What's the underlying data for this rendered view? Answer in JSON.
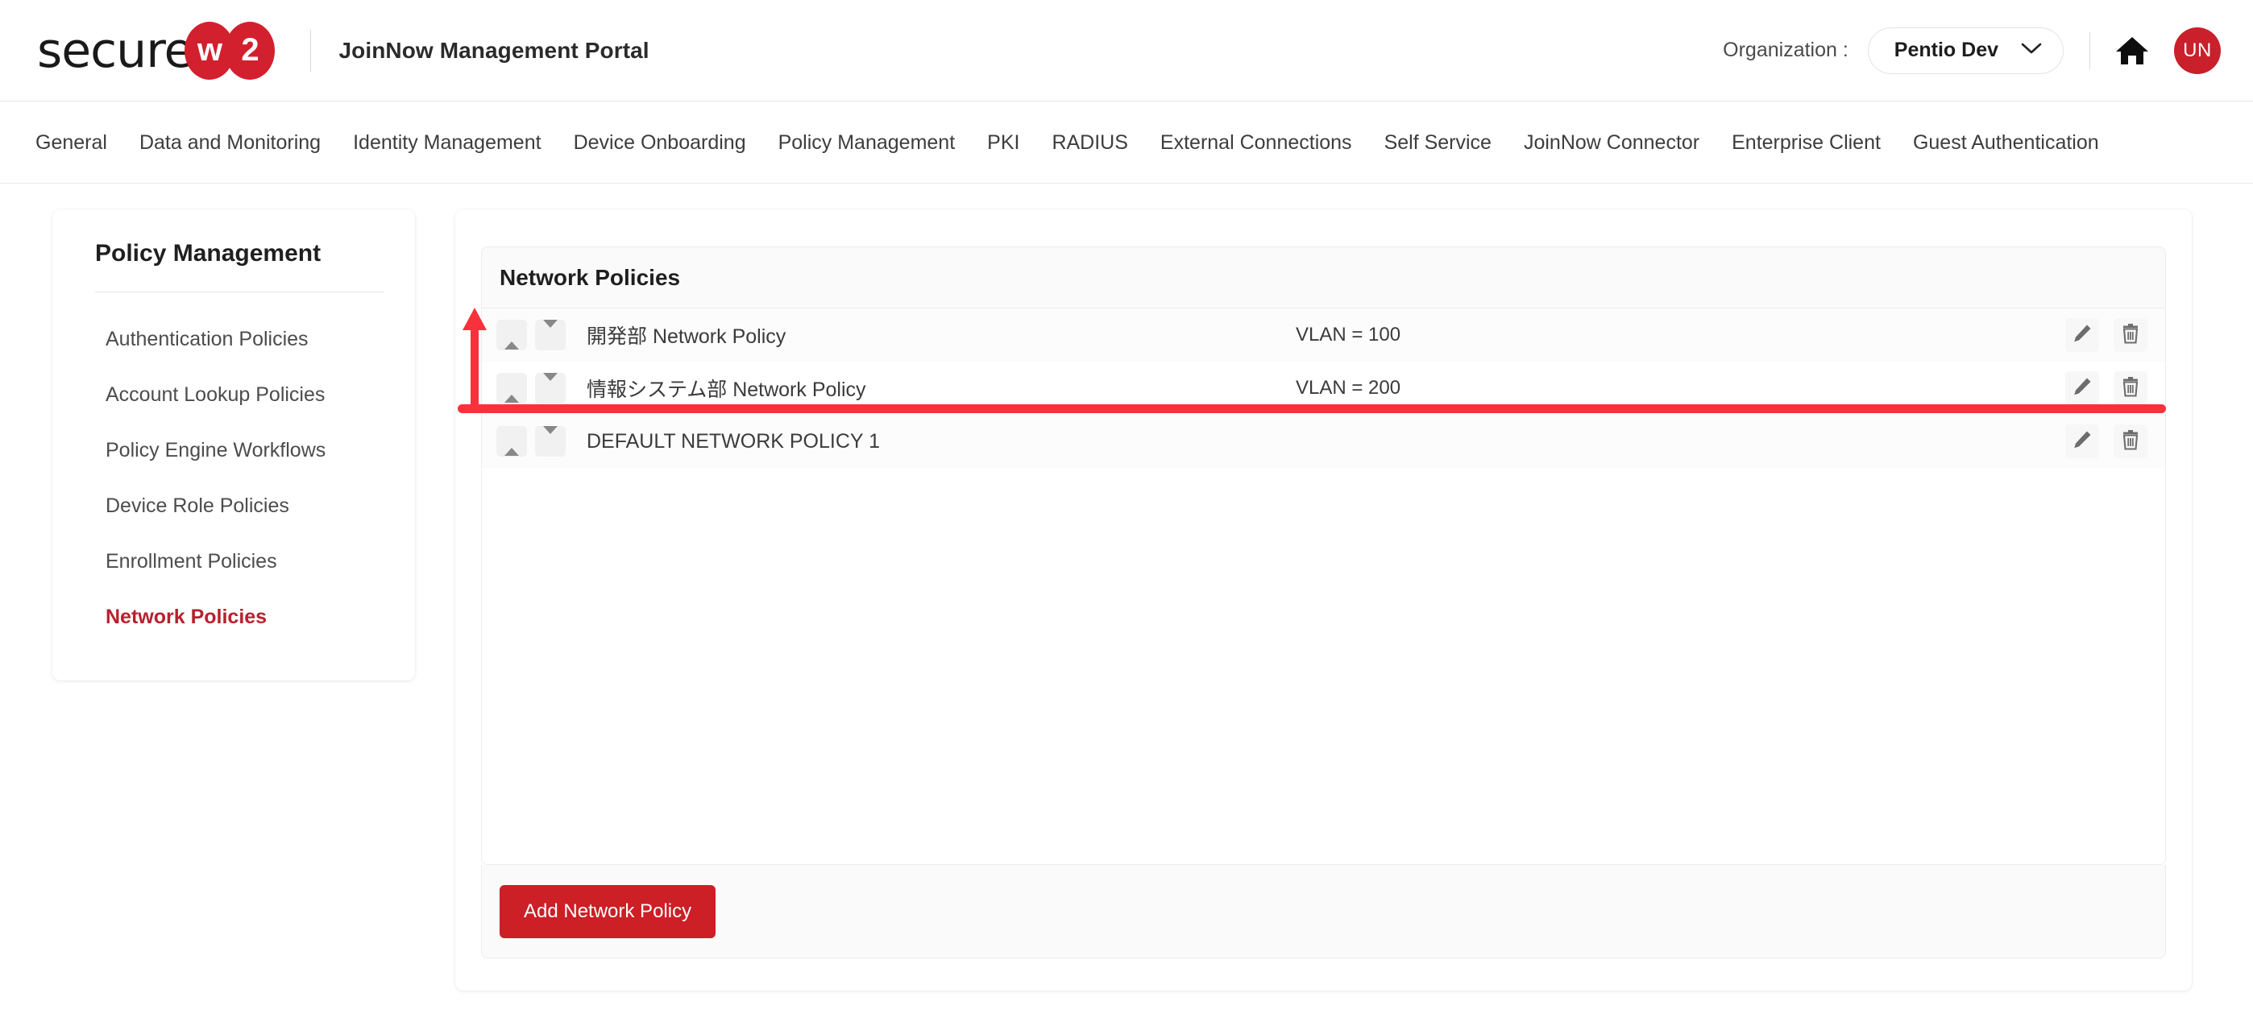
{
  "header": {
    "logo_text": "secure",
    "logo_w": "w",
    "logo_2": "2",
    "portal_title": "JoinNow Management Portal",
    "org_label": "Organization :",
    "org_value": "Pentio Dev",
    "chevron_icon": "chevron-down-icon",
    "home_icon": "home-icon",
    "avatar_initials": "UN"
  },
  "nav": {
    "items": [
      "General",
      "Data and Monitoring",
      "Identity Management",
      "Device Onboarding",
      "Policy Management",
      "PKI",
      "RADIUS",
      "External Connections",
      "Self Service",
      "JoinNow Connector",
      "Enterprise Client",
      "Guest Authentication"
    ]
  },
  "sidebar": {
    "title": "Policy Management",
    "items": [
      {
        "label": "Authentication Policies",
        "active": false
      },
      {
        "label": "Account Lookup Policies",
        "active": false
      },
      {
        "label": "Policy Engine Workflows",
        "active": false
      },
      {
        "label": "Device Role Policies",
        "active": false
      },
      {
        "label": "Enrollment Policies",
        "active": false
      },
      {
        "label": "Network Policies",
        "active": true
      }
    ]
  },
  "main": {
    "panel_title": "Network Policies",
    "rows": [
      {
        "name": "開発部 Network Policy",
        "vlan": "VLAN = 100"
      },
      {
        "name": "情報システム部 Network Policy",
        "vlan": "VLAN = 200"
      },
      {
        "name": "DEFAULT NETWORK POLICY 1",
        "vlan": ""
      }
    ],
    "row_controls": {
      "move_up_icon": "arrow-up-icon",
      "move_down_icon": "arrow-down-icon",
      "edit_icon": "pencil-icon",
      "delete_icon": "trash-icon"
    },
    "add_button_label": "Add Network Policy"
  },
  "annotations": {
    "arrow_icon": "red-up-arrow-annotation",
    "line_icon": "red-underline-annotation",
    "color": "#f9313d"
  },
  "colors": {
    "brand_red": "#d2202f",
    "accent_red": "#cc1f26",
    "active_link": "#b8202e",
    "annotation_red": "#f9313d"
  }
}
